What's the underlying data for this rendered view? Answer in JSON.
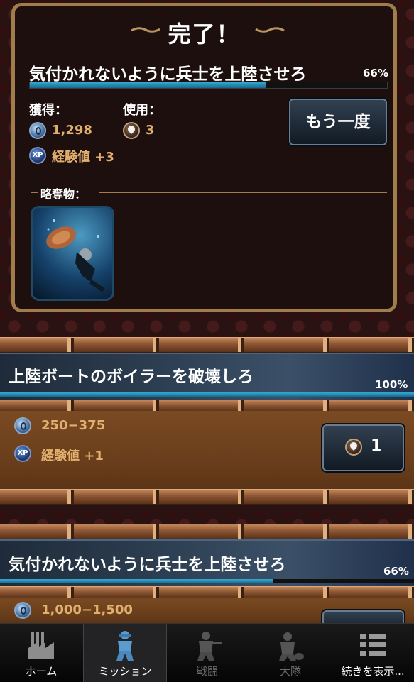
{
  "panel": {
    "title": "完了！",
    "mission_name": "気付かれないように兵士を上陸させろ",
    "progress_text": "66%",
    "progress": 0.66,
    "earned_label": "獲得：",
    "used_label": "使用：",
    "coins": "1,298",
    "xp_text": "経験値 +3",
    "energy_used": "3",
    "retry_button": "もう一度",
    "loot_label": "略奪物："
  },
  "missions": [
    {
      "name": "上陸ボートのボイラーを破壊しろ",
      "progress_text": "100%",
      "progress": 1.0,
      "coins": "250−375",
      "xp_text": "経験値 +1",
      "energy_cost": "1"
    },
    {
      "name": "気付かれないように兵士を上陸させろ",
      "progress_text": "66%",
      "progress": 0.66,
      "coins": "1,000−1,500"
    }
  ],
  "xp_badge": "XP",
  "nav": {
    "items": [
      {
        "label": "ホーム",
        "icon": "factory-icon"
      },
      {
        "label": "ミッション",
        "icon": "soldier-binoculars-icon"
      },
      {
        "label": "戦闘",
        "icon": "soldier-rifle-icon"
      },
      {
        "label": "大隊",
        "icon": "squad-icon"
      },
      {
        "label": "続きを表示...",
        "icon": "more-list-icon"
      }
    ],
    "active": "ミッション"
  },
  "colors": {
    "accent_gold": "#e1b06e",
    "progress_blue": "#2790bc",
    "panel_border": "#a07d4a"
  }
}
